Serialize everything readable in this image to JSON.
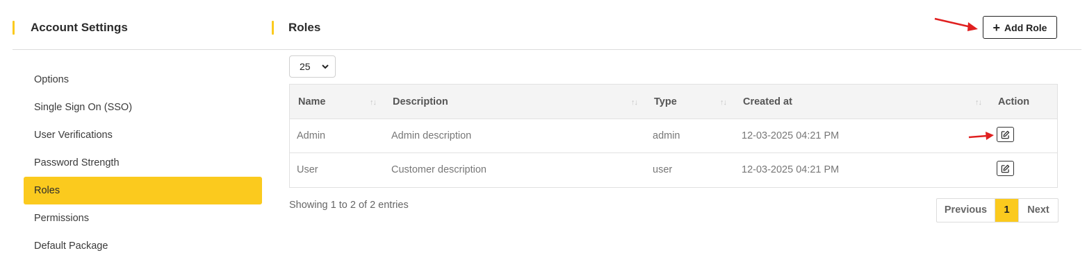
{
  "colors": {
    "accent": "#fbca1e",
    "annotation_arrow": "#e02020"
  },
  "sidebar": {
    "title": "Account Settings",
    "items": [
      {
        "label": "Options",
        "active": false
      },
      {
        "label": "Single Sign On (SSO)",
        "active": false
      },
      {
        "label": "User Verifications",
        "active": false
      },
      {
        "label": "Password Strength",
        "active": false
      },
      {
        "label": "Roles",
        "active": true
      },
      {
        "label": "Permissions",
        "active": false
      },
      {
        "label": "Default Package",
        "active": false
      }
    ]
  },
  "main": {
    "title": "Roles",
    "add_button": {
      "icon": "plus-icon",
      "label": "Add Role"
    },
    "page_size": {
      "value": "25",
      "options": [
        "25"
      ]
    },
    "table": {
      "columns": [
        "Name",
        "Description",
        "Type",
        "Created at",
        "Action"
      ],
      "rows": [
        {
          "name": "Admin",
          "description": "Admin description",
          "type": "admin",
          "created_at": "12-03-2025 04:21 PM",
          "action_icon": "edit-icon"
        },
        {
          "name": "User",
          "description": "Customer description",
          "type": "user",
          "created_at": "12-03-2025 04:21 PM",
          "action_icon": "edit-icon"
        }
      ]
    },
    "showing_text": "Showing 1 to 2 of 2 entries",
    "pagination": {
      "previous": "Previous",
      "current": "1",
      "next": "Next"
    }
  }
}
